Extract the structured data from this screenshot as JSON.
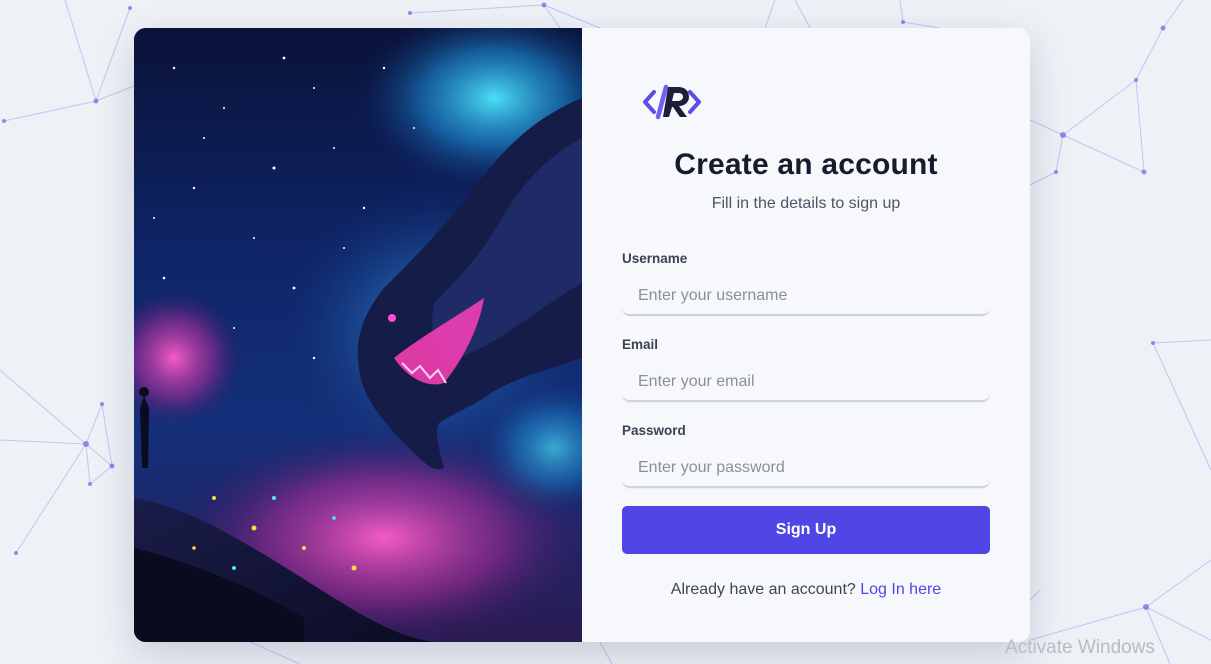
{
  "header": {
    "title": "Create an account",
    "subtitle": "Fill in the details to sign up"
  },
  "form": {
    "username": {
      "label": "Username",
      "placeholder": "Enter your username"
    },
    "email": {
      "label": "Email",
      "placeholder": "Enter your email"
    },
    "password": {
      "label": "Password",
      "placeholder": "Enter your password"
    },
    "submit_label": "Sign Up"
  },
  "footer": {
    "prompt": "Already have an account?",
    "link_label": "Log In here"
  },
  "watermark": "Activate Windows",
  "icons": {
    "logo": "code-r-logo-icon",
    "art": "space-dragon-illustration"
  },
  "colors": {
    "accent": "#4f46e5",
    "background": "#eef1f6",
    "panel": "#f7f8fb",
    "title": "#161b2e"
  }
}
